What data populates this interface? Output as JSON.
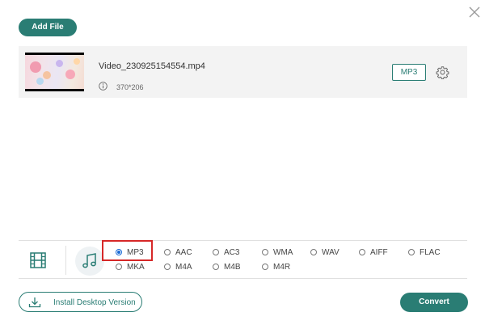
{
  "header": {
    "add_file_label": "Add File"
  },
  "file": {
    "name": "Video_230925154554.mp4",
    "dimensions": "370*206",
    "output_format": "MP3"
  },
  "formats": {
    "selected": "MP3",
    "options": [
      "MP3",
      "AAC",
      "AC3",
      "WMA",
      "WAV",
      "AIFF",
      "FLAC",
      "MKA",
      "M4A",
      "M4B",
      "M4R"
    ]
  },
  "footer": {
    "install_label": "Install Desktop Version",
    "convert_label": "Convert"
  },
  "colors": {
    "accent": "#2a7d74",
    "highlight": "#d62828",
    "radio_selected": "#1a6bd6"
  },
  "icons": {
    "close": "close-icon",
    "info": "info-icon",
    "settings": "gear-icon",
    "video_tab": "film-icon",
    "audio_tab": "music-note-icon",
    "install": "download-icon"
  }
}
